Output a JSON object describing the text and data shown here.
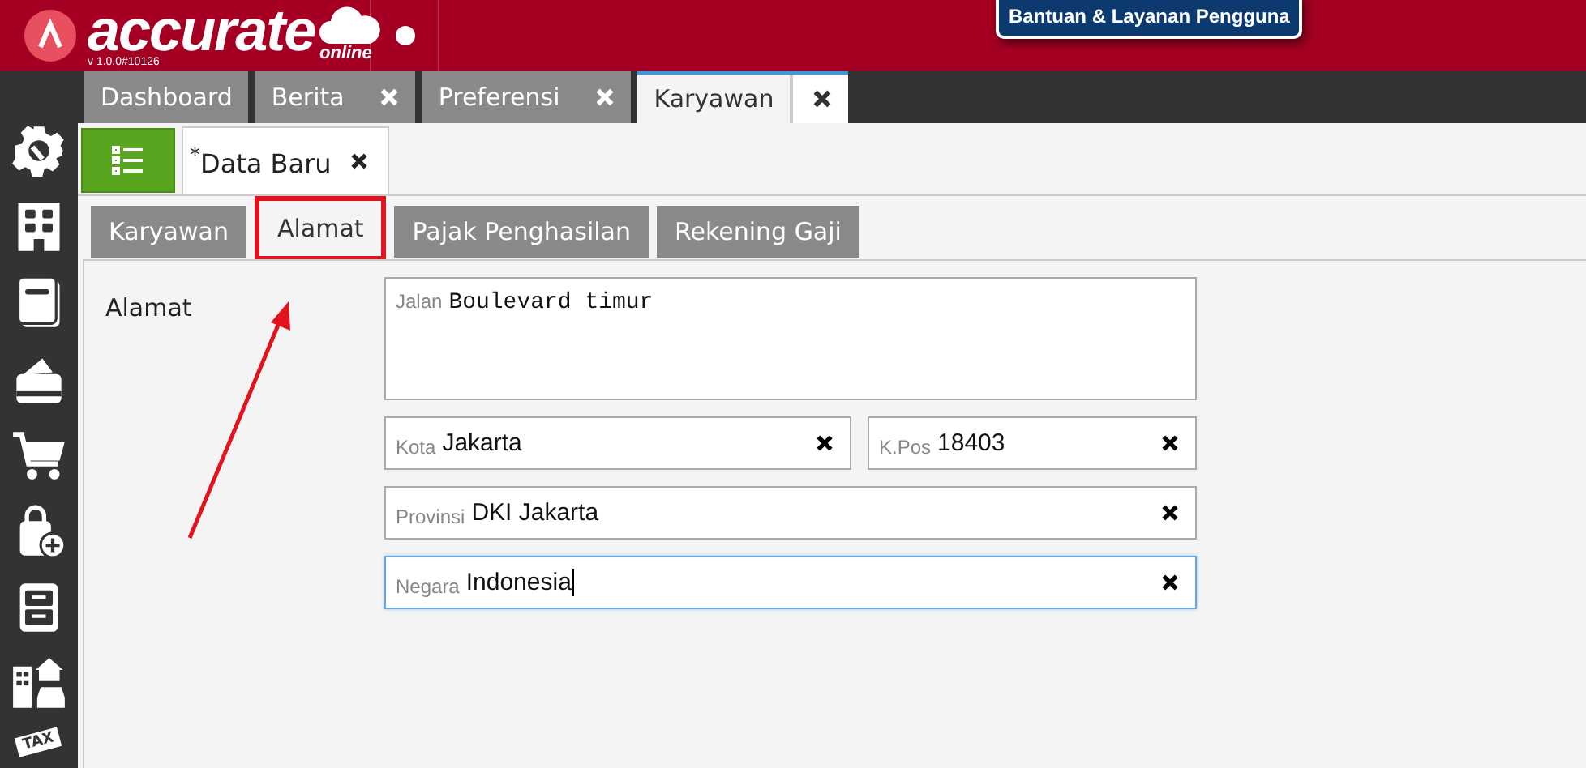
{
  "header": {
    "brand": "accurate",
    "suffix": "online",
    "version": "v 1.0.0#10126",
    "help_button": "Bantuan & Layanan Pengguna"
  },
  "tabs": [
    {
      "label": "Dashboard",
      "closable": false,
      "selected": false
    },
    {
      "label": "Berita",
      "closable": true,
      "selected": false
    },
    {
      "label": "Preferensi",
      "closable": true,
      "selected": false
    },
    {
      "label": "Karyawan",
      "closable": true,
      "selected": true
    }
  ],
  "sidebar": {
    "items": [
      {
        "kind": "settings"
      },
      {
        "kind": "building"
      },
      {
        "kind": "book"
      },
      {
        "kind": "wallet"
      },
      {
        "kind": "cart"
      },
      {
        "kind": "bag"
      },
      {
        "kind": "cabinet"
      },
      {
        "kind": "property"
      },
      {
        "kind": "tax",
        "label": "TAX"
      }
    ]
  },
  "document_tabs": [
    {
      "label": "$^{*}$Data Baru",
      "selected": true
    }
  ],
  "subtabs": [
    {
      "label": "Karyawan",
      "selected": false,
      "highlighted": false
    },
    {
      "label": "Alamat",
      "selected": true,
      "highlighted": true
    },
    {
      "label": "Pajak Penghasilan",
      "selected": false,
      "highlighted": false
    },
    {
      "label": "Rekening Gaji",
      "selected": false,
      "highlighted": false
    }
  ],
  "form": {
    "label": "Alamat",
    "street": {
      "label": "Jalan",
      "value": "Boulevard timur"
    },
    "rows": [
      [
        {
          "label": "Kota",
          "value": "Jakarta",
          "focused": false
        },
        {
          "label": "K.Pos",
          "value": "18403",
          "focused": false
        }
      ],
      [
        {
          "label": "Provinsi",
          "value": "DKI Jakarta",
          "focused": false
        }
      ],
      [
        {
          "label": "Negara",
          "value": "Indonesia",
          "focused": true
        }
      ]
    ]
  }
}
